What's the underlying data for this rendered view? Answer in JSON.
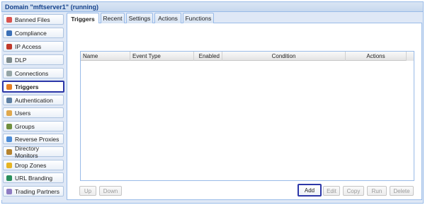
{
  "window": {
    "title": "Domain \"mftserver1\" (running)"
  },
  "sidebar": {
    "items": [
      {
        "label": "Banned Files",
        "icon": "banned-files-icon",
        "color": "#d9534f"
      },
      {
        "label": "Compliance",
        "icon": "user-icon",
        "color": "#3b6fb6"
      },
      {
        "label": "IP Access",
        "icon": "ip-access-icon",
        "color": "#c0392b"
      },
      {
        "label": "DLP",
        "icon": "shield-icon",
        "color": "#7f8c8d"
      },
      {
        "label": "Connections",
        "icon": "connections-icon",
        "color": "#95a5a6"
      },
      {
        "label": "Triggers",
        "icon": "triggers-icon",
        "color": "#e67e22",
        "selected": true
      },
      {
        "label": "Authentication",
        "icon": "authentication-icon",
        "color": "#5d7fa3"
      },
      {
        "label": "Users",
        "icon": "users-icon",
        "color": "#e0a84d"
      },
      {
        "label": "Groups",
        "icon": "groups-icon",
        "color": "#6f8f3f"
      },
      {
        "label": "Reverse Proxies",
        "icon": "reverse-proxies-icon",
        "color": "#4b8bd6"
      },
      {
        "label": "Directory Monitors",
        "icon": "directory-monitors-icon",
        "color": "#b5832f"
      },
      {
        "label": "Drop Zones",
        "icon": "drop-zones-icon",
        "color": "#e6b422"
      },
      {
        "label": "URL Branding",
        "icon": "globe-icon",
        "color": "#2a8f5c"
      },
      {
        "label": "Trading Partners",
        "icon": "trading-partners-icon",
        "color": "#8e7cc3"
      }
    ]
  },
  "tabs": [
    {
      "label": "Triggers",
      "active": true
    },
    {
      "label": "Recent"
    },
    {
      "label": "Settings"
    },
    {
      "label": "Actions"
    },
    {
      "label": "Functions"
    }
  ],
  "grid": {
    "columns": [
      "Name",
      "Event Type",
      "Enabled",
      "Condition",
      "Actions"
    ]
  },
  "buttons": {
    "up": "Up",
    "down": "Down",
    "add": "Add",
    "edit": "Edit",
    "copy": "Copy",
    "run": "Run",
    "delete": "Delete"
  },
  "colors": {
    "highlight": "#2c37a8",
    "border": "#99bbe8",
    "panel_bg": "#dfe8f6"
  }
}
